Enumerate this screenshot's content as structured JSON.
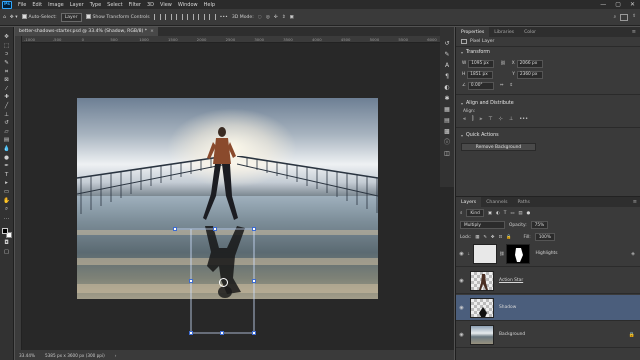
{
  "menubar": {
    "logo": "Ps",
    "items": [
      "File",
      "Edit",
      "Image",
      "Layer",
      "Type",
      "Select",
      "Filter",
      "3D",
      "View",
      "Window",
      "Help"
    ],
    "window_controls": [
      "—",
      "▢",
      "✕"
    ]
  },
  "options_bar": {
    "auto_select_label": "Auto-Select:",
    "auto_select_target": "Layer",
    "transform_controls_label": "Show Transform Controls",
    "mode_3d_label": "3D Mode:"
  },
  "document": {
    "tab_title": "better-shadows-starter.psd @ 33.4% (Shadow, RGB/8) *",
    "close_glyph": "×",
    "ruler_ticks": [
      "-1000",
      "-500",
      "0",
      "500",
      "1000",
      "1500",
      "2000",
      "2500",
      "3000",
      "3500",
      "4000",
      "4500",
      "5000",
      "5500",
      "6000"
    ]
  },
  "status_bar": {
    "zoom": "33.44%",
    "doc_info": "5385 px x 3600 px (300 ppi)"
  },
  "tools": [
    "move-icon",
    "marquee-icon",
    "lasso-icon",
    "quick-select-icon",
    "crop-icon",
    "frame-icon",
    "eyedropper-icon",
    "healing-icon",
    "brush-icon",
    "stamp-icon",
    "history-brush-icon",
    "eraser-icon",
    "gradient-icon",
    "blur-icon",
    "dodge-icon",
    "pen-icon",
    "type-icon",
    "path-select-icon",
    "shape-icon",
    "hand-icon",
    "zoom-icon",
    "edit-toolbar-icon"
  ],
  "properties_panel": {
    "tabs": [
      "Properties",
      "Libraries",
      "Color"
    ],
    "layer_kind": "Pixel Layer",
    "transform_title": "Transform",
    "w_label": "W",
    "w_value": "1095 px",
    "x_label": "X",
    "x_value": "2066 px",
    "h_label": "H",
    "h_value": "1851 px",
    "y_label": "Y",
    "y_value": "2360 px",
    "angle_value": "0.00°",
    "align_title": "Align and Distribute",
    "align_label": "Align:",
    "quick_actions_title": "Quick Actions",
    "remove_bg_label": "Remove Background"
  },
  "layers_panel": {
    "tabs": [
      "Layers",
      "Channels",
      "Paths"
    ],
    "filter_kind": "Kind",
    "blend_mode": "Multiply",
    "opacity_label": "Opacity:",
    "opacity_value": "75%",
    "lock_label": "Lock:",
    "fill_label": "Fill:",
    "fill_value": "100%",
    "layers": [
      {
        "name": "Highlights",
        "selected": false
      },
      {
        "name": "Action Star",
        "selected": false
      },
      {
        "name": "Shadow",
        "selected": true
      },
      {
        "name": "Background",
        "selected": false
      }
    ]
  },
  "colors": {
    "selection": "#4b5e7c",
    "accent": "#31a8ff"
  }
}
